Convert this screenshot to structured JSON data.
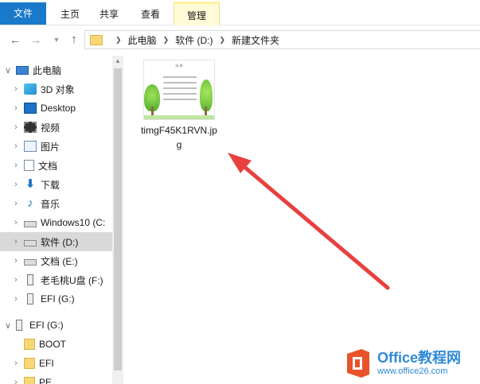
{
  "ribbon": {
    "tabs": [
      "文件",
      "主页",
      "共享",
      "查看",
      "管理"
    ],
    "file_tab_color": "#1979ca",
    "manage_tab_color": "#fffbd6"
  },
  "address": {
    "segments": [
      "此电脑",
      "软件 (D:)",
      "新建文件夹"
    ]
  },
  "nav": {
    "items": [
      {
        "label": "此电脑",
        "icon": "computer-icon",
        "expanded": true
      },
      {
        "label": "3D 对象",
        "icon": "3d-objects-icon"
      },
      {
        "label": "Desktop",
        "icon": "desktop-icon"
      },
      {
        "label": "视频",
        "icon": "video-icon"
      },
      {
        "label": "图片",
        "icon": "picture-icon"
      },
      {
        "label": "文档",
        "icon": "document-icon"
      },
      {
        "label": "下载",
        "icon": "download-icon"
      },
      {
        "label": "音乐",
        "icon": "music-icon"
      },
      {
        "label": "Windows10 (C:",
        "icon": "drive-icon"
      },
      {
        "label": "软件 (D:)",
        "icon": "drive-icon",
        "selected": true
      },
      {
        "label": "文档 (E:)",
        "icon": "drive-icon"
      },
      {
        "label": "老毛桃U盘 (F:)",
        "icon": "usb-drive-icon"
      },
      {
        "label": "EFI (G:)",
        "icon": "usb-drive-icon"
      },
      {
        "label": "EFI (G:)",
        "icon": "usb-drive-icon",
        "expanded": true
      },
      {
        "label": "BOOT",
        "icon": "folder-icon"
      },
      {
        "label": "EFI",
        "icon": "folder-icon"
      },
      {
        "label": "PE",
        "icon": "folder-icon"
      }
    ]
  },
  "files": [
    {
      "name": "timgF45K1RVN.jpg",
      "thumb_title": "咏 柳"
    }
  ],
  "annotation": {
    "arrow_color": "#e8413f"
  },
  "watermark": {
    "title": "Office教程网",
    "url": "www.office26.com",
    "logo_color": "#e8532a"
  }
}
